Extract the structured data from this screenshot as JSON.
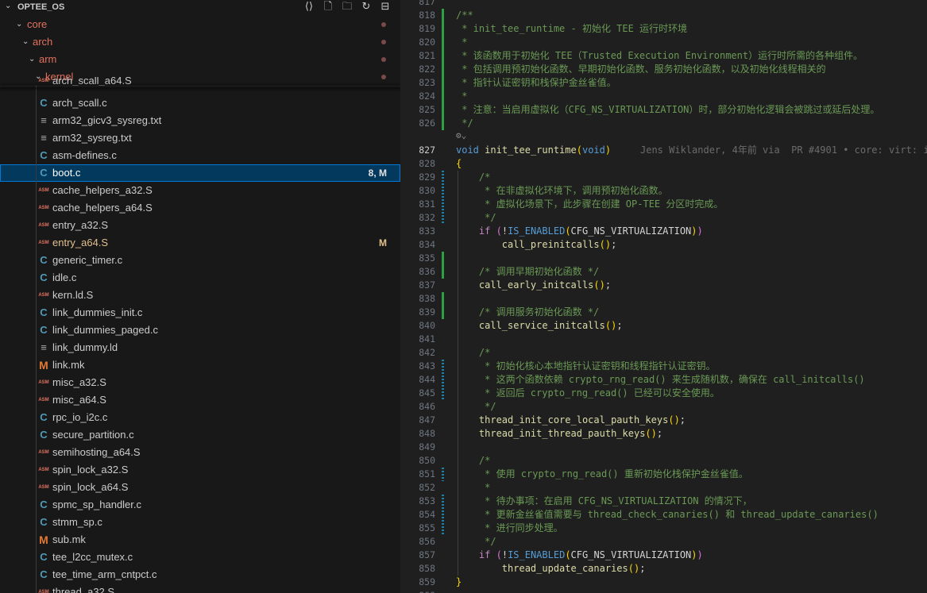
{
  "explorer": {
    "root_title": "OPTEE_OS",
    "actions": [
      {
        "name": "open-editors-icon",
        "glyph": "⟨⟩"
      },
      {
        "name": "new-file-icon",
        "glyph": "🗋"
      },
      {
        "name": "new-folder-icon",
        "glyph": "🗀"
      },
      {
        "name": "refresh-icon",
        "glyph": "↻"
      },
      {
        "name": "collapse-all-icon",
        "glyph": "⊟"
      }
    ],
    "folders": [
      {
        "label": "core"
      },
      {
        "label": "arch"
      },
      {
        "label": "arm"
      },
      {
        "label": "kernel"
      }
    ],
    "files": [
      {
        "label": "arch_scall_a64.S",
        "icon": "asm"
      },
      {
        "label": "arch_scall.c",
        "icon": "c"
      },
      {
        "label": "arm32_gicv3_sysreg.txt",
        "icon": "txt"
      },
      {
        "label": "arm32_sysreg.txt",
        "icon": "txt"
      },
      {
        "label": "asm-defines.c",
        "icon": "c"
      },
      {
        "label": "boot.c",
        "icon": "c",
        "badge": "8, M",
        "state": "selected"
      },
      {
        "label": "cache_helpers_a32.S",
        "icon": "asm"
      },
      {
        "label": "cache_helpers_a64.S",
        "icon": "asm"
      },
      {
        "label": "entry_a32.S",
        "icon": "asm"
      },
      {
        "label": "entry_a64.S",
        "icon": "asm",
        "badge": "M",
        "state": "modified"
      },
      {
        "label": "generic_timer.c",
        "icon": "c"
      },
      {
        "label": "idle.c",
        "icon": "c"
      },
      {
        "label": "kern.ld.S",
        "icon": "asm"
      },
      {
        "label": "link_dummies_init.c",
        "icon": "c"
      },
      {
        "label": "link_dummies_paged.c",
        "icon": "c"
      },
      {
        "label": "link_dummy.ld",
        "icon": "txt"
      },
      {
        "label": "link.mk",
        "icon": "mk"
      },
      {
        "label": "misc_a32.S",
        "icon": "asm"
      },
      {
        "label": "misc_a64.S",
        "icon": "asm"
      },
      {
        "label": "rpc_io_i2c.c",
        "icon": "c"
      },
      {
        "label": "secure_partition.c",
        "icon": "c"
      },
      {
        "label": "semihosting_a64.S",
        "icon": "asm"
      },
      {
        "label": "spin_lock_a32.S",
        "icon": "asm"
      },
      {
        "label": "spin_lock_a64.S",
        "icon": "asm"
      },
      {
        "label": "spmc_sp_handler.c",
        "icon": "c"
      },
      {
        "label": "stmm_sp.c",
        "icon": "c"
      },
      {
        "label": "sub.mk",
        "icon": "mk"
      },
      {
        "label": "tee_l2cc_mutex.c",
        "icon": "c"
      },
      {
        "label": "tee_time_arm_cntpct.c",
        "icon": "c"
      },
      {
        "label": "thread_a32.S",
        "icon": "asm"
      }
    ],
    "icon_glyphs": {
      "c": "C",
      "asm": "ASM",
      "txt": "≡",
      "mk": "M"
    }
  },
  "editor": {
    "lines": [
      {
        "n": "817",
        "code": []
      },
      {
        "n": "818",
        "code": [
          [
            "cm",
            "/**"
          ]
        ]
      },
      {
        "n": "819",
        "code": [
          [
            "cm",
            " * init_tee_runtime - 初始化 TEE 运行时环境"
          ]
        ]
      },
      {
        "n": "820",
        "code": [
          [
            "cm",
            " *"
          ]
        ]
      },
      {
        "n": "821",
        "code": [
          [
            "cm",
            " * 该函数用于初始化 TEE（Trusted Execution Environment）运行时所需的各种组件。"
          ]
        ]
      },
      {
        "n": "822",
        "code": [
          [
            "cm",
            " * 包括调用预初始化函数、早期初始化函数、服务初始化函数，以及初始化线程相关的"
          ]
        ]
      },
      {
        "n": "823",
        "code": [
          [
            "cm",
            " * 指针认证密钥和栈保护金丝雀值。"
          ]
        ]
      },
      {
        "n": "824",
        "code": [
          [
            "cm",
            " *"
          ]
        ]
      },
      {
        "n": "825",
        "code": [
          [
            "cm",
            " * 注意：当启用虚拟化（CFG_NS_VIRTUALIZATION）时，部分初始化逻辑会被跳过或延后处理。"
          ]
        ]
      },
      {
        "n": "826",
        "code": [
          [
            "cm",
            " */"
          ]
        ]
      },
      {
        "n": "827",
        "code": [
          [
            "kw",
            "void"
          ],
          [
            "txt",
            " "
          ],
          [
            "fn",
            "init_tee_runtime"
          ],
          [
            "brk",
            "("
          ],
          [
            "kw",
            "void"
          ],
          [
            "brk",
            ")"
          ]
        ],
        "blame": "Jens Wiklander, 4年前 via  PR #4901 • core: virt: in"
      },
      {
        "n": "828",
        "code": [
          [
            "brk",
            "{"
          ]
        ]
      },
      {
        "n": "829",
        "code": [
          [
            "cm",
            "    /*"
          ]
        ]
      },
      {
        "n": "830",
        "code": [
          [
            "cm",
            "     * 在非虚拟化环境下，调用预初始化函数。"
          ]
        ]
      },
      {
        "n": "831",
        "code": [
          [
            "cm",
            "     * 虚拟化场景下，此步骤在创建 OP-TEE 分区时完成。"
          ]
        ]
      },
      {
        "n": "832",
        "code": [
          [
            "cm",
            "     */"
          ]
        ]
      },
      {
        "n": "833",
        "code": [
          [
            "txt",
            "    "
          ],
          [
            "kwc",
            "if"
          ],
          [
            "txt",
            " "
          ],
          [
            "brk2",
            "("
          ],
          [
            "txt",
            "!"
          ],
          [
            "mac",
            "IS_ENABLED"
          ],
          [
            "brk",
            "("
          ],
          [
            "txt",
            "CFG_NS_VIRTUALIZATION"
          ],
          [
            "brk",
            ")"
          ],
          [
            "brk2",
            ")"
          ]
        ]
      },
      {
        "n": "834",
        "code": [
          [
            "txt",
            "        "
          ],
          [
            "fn",
            "call_preinitcalls"
          ],
          [
            "brk",
            "("
          ],
          [
            "brk",
            ")"
          ],
          [
            "txt",
            ";"
          ]
        ]
      },
      {
        "n": "835",
        "code": []
      },
      {
        "n": "836",
        "code": [
          [
            "cm",
            "    /* 调用早期初始化函数 */"
          ]
        ]
      },
      {
        "n": "837",
        "code": [
          [
            "txt",
            "    "
          ],
          [
            "fn",
            "call_early_initcalls"
          ],
          [
            "brk",
            "("
          ],
          [
            "brk",
            ")"
          ],
          [
            "txt",
            ";"
          ]
        ]
      },
      {
        "n": "838",
        "code": []
      },
      {
        "n": "839",
        "code": [
          [
            "cm",
            "    /* 调用服务初始化函数 */"
          ]
        ]
      },
      {
        "n": "840",
        "code": [
          [
            "txt",
            "    "
          ],
          [
            "fn",
            "call_service_initcalls"
          ],
          [
            "brk",
            "("
          ],
          [
            "brk",
            ")"
          ],
          [
            "txt",
            ";"
          ]
        ]
      },
      {
        "n": "841",
        "code": []
      },
      {
        "n": "842",
        "code": [
          [
            "cm",
            "    /*"
          ]
        ]
      },
      {
        "n": "843",
        "code": [
          [
            "cm",
            "     * 初始化核心本地指针认证密钥和线程指针认证密钥。"
          ]
        ]
      },
      {
        "n": "844",
        "code": [
          [
            "cm",
            "     * 这两个函数依赖 crypto_rng_read() 来生成随机数，确保在 call_initcalls()"
          ]
        ]
      },
      {
        "n": "845",
        "code": [
          [
            "cm",
            "     * 返回后 crypto_rng_read() 已经可以安全使用。"
          ]
        ]
      },
      {
        "n": "846",
        "code": [
          [
            "cm",
            "     */"
          ]
        ]
      },
      {
        "n": "847",
        "code": [
          [
            "txt",
            "    "
          ],
          [
            "fn",
            "thread_init_core_local_pauth_keys"
          ],
          [
            "brk",
            "("
          ],
          [
            "brk",
            ")"
          ],
          [
            "txt",
            ";"
          ]
        ]
      },
      {
        "n": "848",
        "code": [
          [
            "txt",
            "    "
          ],
          [
            "fn",
            "thread_init_thread_pauth_keys"
          ],
          [
            "brk",
            "("
          ],
          [
            "brk",
            ")"
          ],
          [
            "txt",
            ";"
          ]
        ]
      },
      {
        "n": "849",
        "code": []
      },
      {
        "n": "850",
        "code": [
          [
            "cm",
            "    /*"
          ]
        ]
      },
      {
        "n": "851",
        "code": [
          [
            "cm",
            "     * 使用 crypto_rng_read() 重新初始化栈保护金丝雀值。"
          ]
        ]
      },
      {
        "n": "852",
        "code": [
          [
            "cm",
            "     *"
          ]
        ]
      },
      {
        "n": "853",
        "code": [
          [
            "cm",
            "     * 待办事项：在启用 CFG_NS_VIRTUALIZATION 的情况下，"
          ]
        ]
      },
      {
        "n": "854",
        "code": [
          [
            "cm",
            "     * 更新金丝雀值需要与 thread_check_canaries() 和 thread_update_canaries()"
          ]
        ]
      },
      {
        "n": "855",
        "code": [
          [
            "cm",
            "     * 进行同步处理。"
          ]
        ]
      },
      {
        "n": "856",
        "code": [
          [
            "cm",
            "     */"
          ]
        ]
      },
      {
        "n": "857",
        "code": [
          [
            "txt",
            "    "
          ],
          [
            "kwc",
            "if"
          ],
          [
            "txt",
            " "
          ],
          [
            "brk2",
            "("
          ],
          [
            "txt",
            "!"
          ],
          [
            "mac",
            "IS_ENABLED"
          ],
          [
            "brk",
            "("
          ],
          [
            "txt",
            "CFG_NS_VIRTUALIZATION"
          ],
          [
            "brk",
            ")"
          ],
          [
            "brk2",
            ")"
          ]
        ]
      },
      {
        "n": "858",
        "code": [
          [
            "txt",
            "        "
          ],
          [
            "fn",
            "thread_update_canaries"
          ],
          [
            "brk",
            "("
          ],
          [
            "brk",
            ")"
          ],
          [
            "txt",
            ";"
          ]
        ]
      },
      {
        "n": "859",
        "code": [
          [
            "brk",
            "}"
          ]
        ]
      },
      {
        "n": "860",
        "code": []
      }
    ]
  }
}
